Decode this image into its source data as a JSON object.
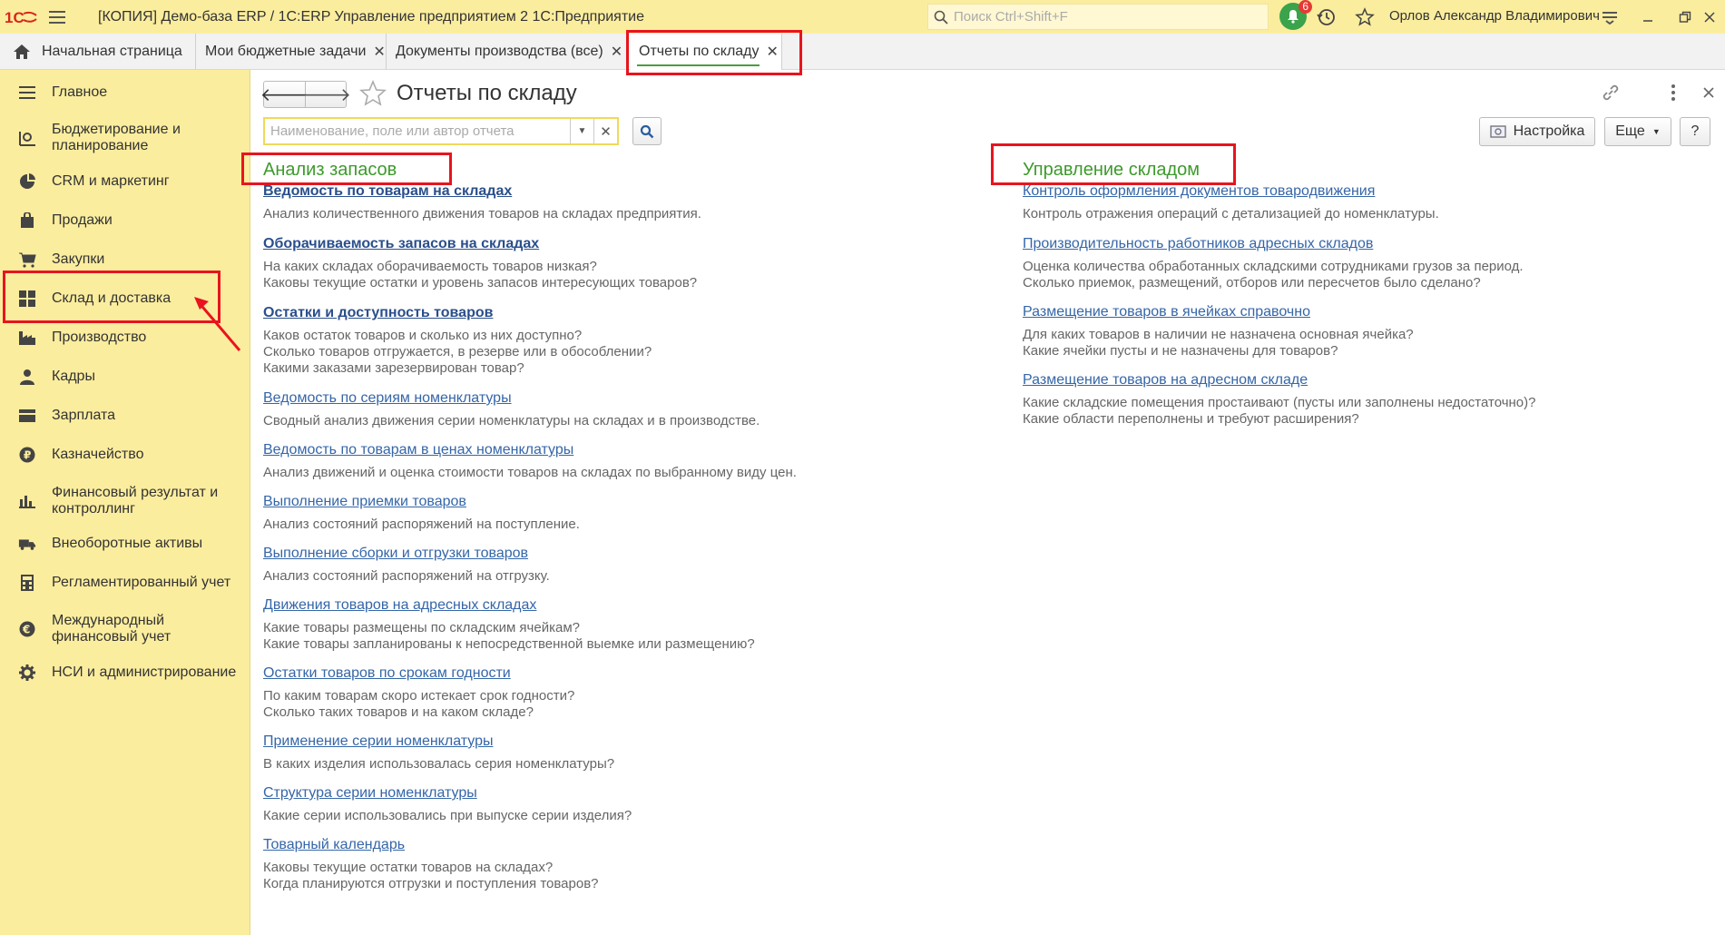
{
  "titlebar": {
    "logo_text": "1С",
    "title": "[КОПИЯ] Демо-база ERP / 1С:ERP Управление предприятием 2 1С:Предприятие",
    "search_placeholder": "Поиск Ctrl+Shift+F",
    "notifications_count": "6",
    "user": "Орлов Александр Владимирович"
  },
  "tabs": [
    {
      "label": "Начальная страница",
      "icon": "home-icon"
    },
    {
      "label": "Мои бюджетные задачи",
      "closable": true
    },
    {
      "label": "Документы производства (все)",
      "closable": true
    },
    {
      "label": "Отчеты по складу",
      "closable": true,
      "active": true
    }
  ],
  "sidebar": {
    "items": [
      {
        "label": "Главное",
        "icon": "menu-lines-icon"
      },
      {
        "label": "Бюджетирование и планирование",
        "icon": "budget-icon"
      },
      {
        "label": "CRM и маркетинг",
        "icon": "pie-chart-icon"
      },
      {
        "label": "Продажи",
        "icon": "bag-icon"
      },
      {
        "label": "Закупки",
        "icon": "cart-icon"
      },
      {
        "label": "Склад и доставка",
        "icon": "warehouse-grid-icon",
        "selected": true
      },
      {
        "label": "Производство",
        "icon": "factory-icon"
      },
      {
        "label": "Кадры",
        "icon": "person-icon"
      },
      {
        "label": "Зарплата",
        "icon": "wallet-icon"
      },
      {
        "label": "Казначейство",
        "icon": "ruble-coin-icon"
      },
      {
        "label": "Финансовый результат и контроллинг",
        "icon": "bar-chart-icon"
      },
      {
        "label": "Внеоборотные активы",
        "icon": "truck-icon"
      },
      {
        "label": "Регламентированный учет",
        "icon": "calculator-icon"
      },
      {
        "label": "Международный финансовый учет",
        "icon": "euro-coin-icon"
      },
      {
        "label": "НСИ и администрирование",
        "icon": "gear-icon"
      }
    ]
  },
  "page": {
    "title": "Отчеты по складу",
    "filter_placeholder": "Наименование, поле или автор отчета",
    "settings_label": "Настройка",
    "more_label": "Еще",
    "help_label": "?"
  },
  "sections": {
    "left": {
      "title": "Анализ запасов",
      "reports": [
        {
          "name": "Ведомость по товарам на складах",
          "desc": "Анализ количественного движения товаров на складах предприятия."
        },
        {
          "name": "Оборачиваемость запасов на складах",
          "desc": "На каких складах оборачиваемость товаров низкая?\nКаковы текущие остатки и уровень запасов интересующих товаров?"
        },
        {
          "name": "Остатки и доступность товаров",
          "desc": "Каков остаток товаров и сколько из них доступно?\nСколько товаров отгружается, в резерве или в обособлении?\nКакими заказами зарезервирован товар?"
        },
        {
          "name": "Ведомость по сериям номенклатуры",
          "desc": "Сводный анализ движения серии номенклатуры на складах и в производстве."
        },
        {
          "name": "Ведомость по товарам в ценах номенклатуры",
          "desc": "Анализ движений и оценка стоимости товаров на складах по выбранному виду цен."
        },
        {
          "name": "Выполнение приемки товаров",
          "desc": "Анализ состояний распоряжений на поступление."
        },
        {
          "name": "Выполнение сборки и отгрузки товаров",
          "desc": "Анализ состояний распоряжений на отгрузку."
        },
        {
          "name": "Движения товаров на адресных складах",
          "desc": "Какие товары размещены по складским ячейкам?\nКакие товары запланированы к непосредственной выемке или размещению?"
        },
        {
          "name": "Остатки товаров по срокам годности",
          "desc": "По каким товарам скоро истекает срок годности?\nСколько таких товаров и на каком складе?"
        },
        {
          "name": "Применение серии номенклатуры",
          "desc": "В каких изделия использовалась серия номенклатуры?"
        },
        {
          "name": "Структура серии номенклатуры",
          "desc": "Какие серии использовались при выпуске серии изделия?"
        },
        {
          "name": "Товарный календарь",
          "desc": "Каковы текущие остатки товаров на складах?\nКогда планируются отгрузки и поступления товаров?"
        }
      ]
    },
    "right": {
      "title": "Управление складом",
      "reports": [
        {
          "name": "Контроль оформления документов товародвижения",
          "desc": "Контроль отражения операций с детализацией до номенклатуры."
        },
        {
          "name": "Производительность работников адресных складов",
          "desc": "Оценка количества обработанных складскими сотрудниками грузов за период.\nСколько приемок, размещений, отборов или пересчетов было сделано?"
        },
        {
          "name": "Размещение товаров в ячейках справочно",
          "desc": "Для каких товаров в наличии не назначена основная ячейка?\nКакие ячейки пусты и не назначены для товаров?"
        },
        {
          "name": "Размещение товаров на адресном складе",
          "desc": "Какие складские помещения простаивают (пусты или заполнены недостаточно)?\nКакие области переполнены и требуют расширения?"
        }
      ]
    }
  },
  "colors": {
    "sidebar_bg": "#fbed9e",
    "section_title": "#3d9a2c",
    "link": "#3566a8",
    "highlight": "#e8141e"
  }
}
